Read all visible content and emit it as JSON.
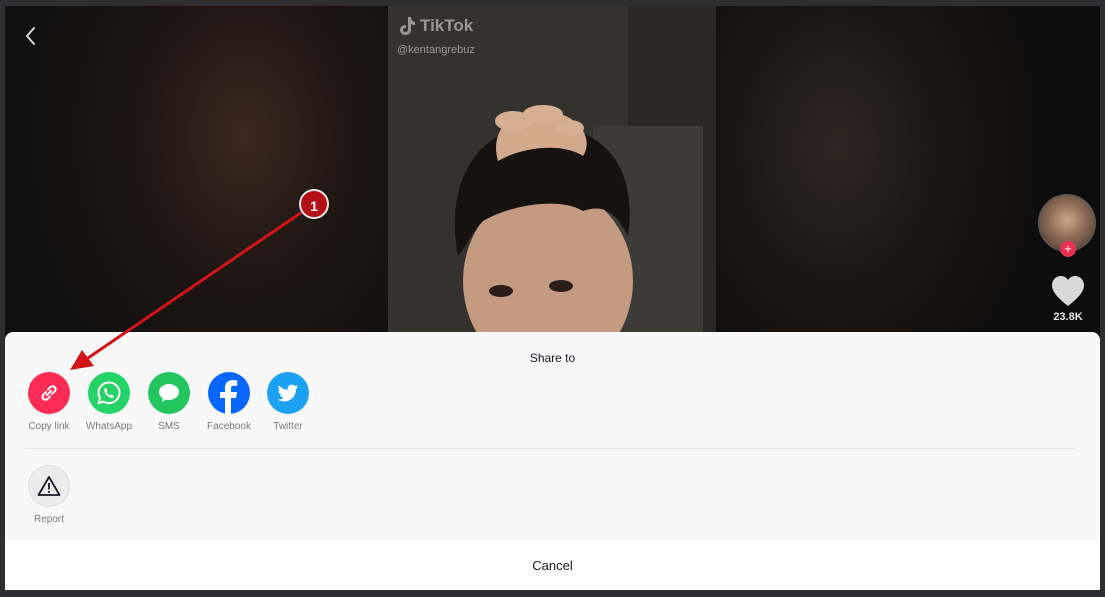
{
  "video": {
    "watermark_brand": "TikTok",
    "watermark_handle": "@kentangrebuz"
  },
  "side_actions": {
    "follow_symbol": "+",
    "like_count": "23.8K"
  },
  "share_sheet": {
    "title": "Share to",
    "options": [
      {
        "label": "Copy link",
        "icon": "link-icon",
        "color": "#fe2c55"
      },
      {
        "label": "WhatsApp",
        "icon": "whatsapp-icon",
        "color": "#25d366"
      },
      {
        "label": "SMS",
        "icon": "sms-icon",
        "color": "#22c55e"
      },
      {
        "label": "Facebook",
        "icon": "facebook-icon",
        "color": "#0866ff"
      },
      {
        "label": "Twitter",
        "icon": "twitter-icon",
        "color": "#1da1f2"
      }
    ],
    "report_label": "Report",
    "cancel_label": "Cancel"
  },
  "annotation": {
    "step_number": "1",
    "color": "#d0141a"
  }
}
